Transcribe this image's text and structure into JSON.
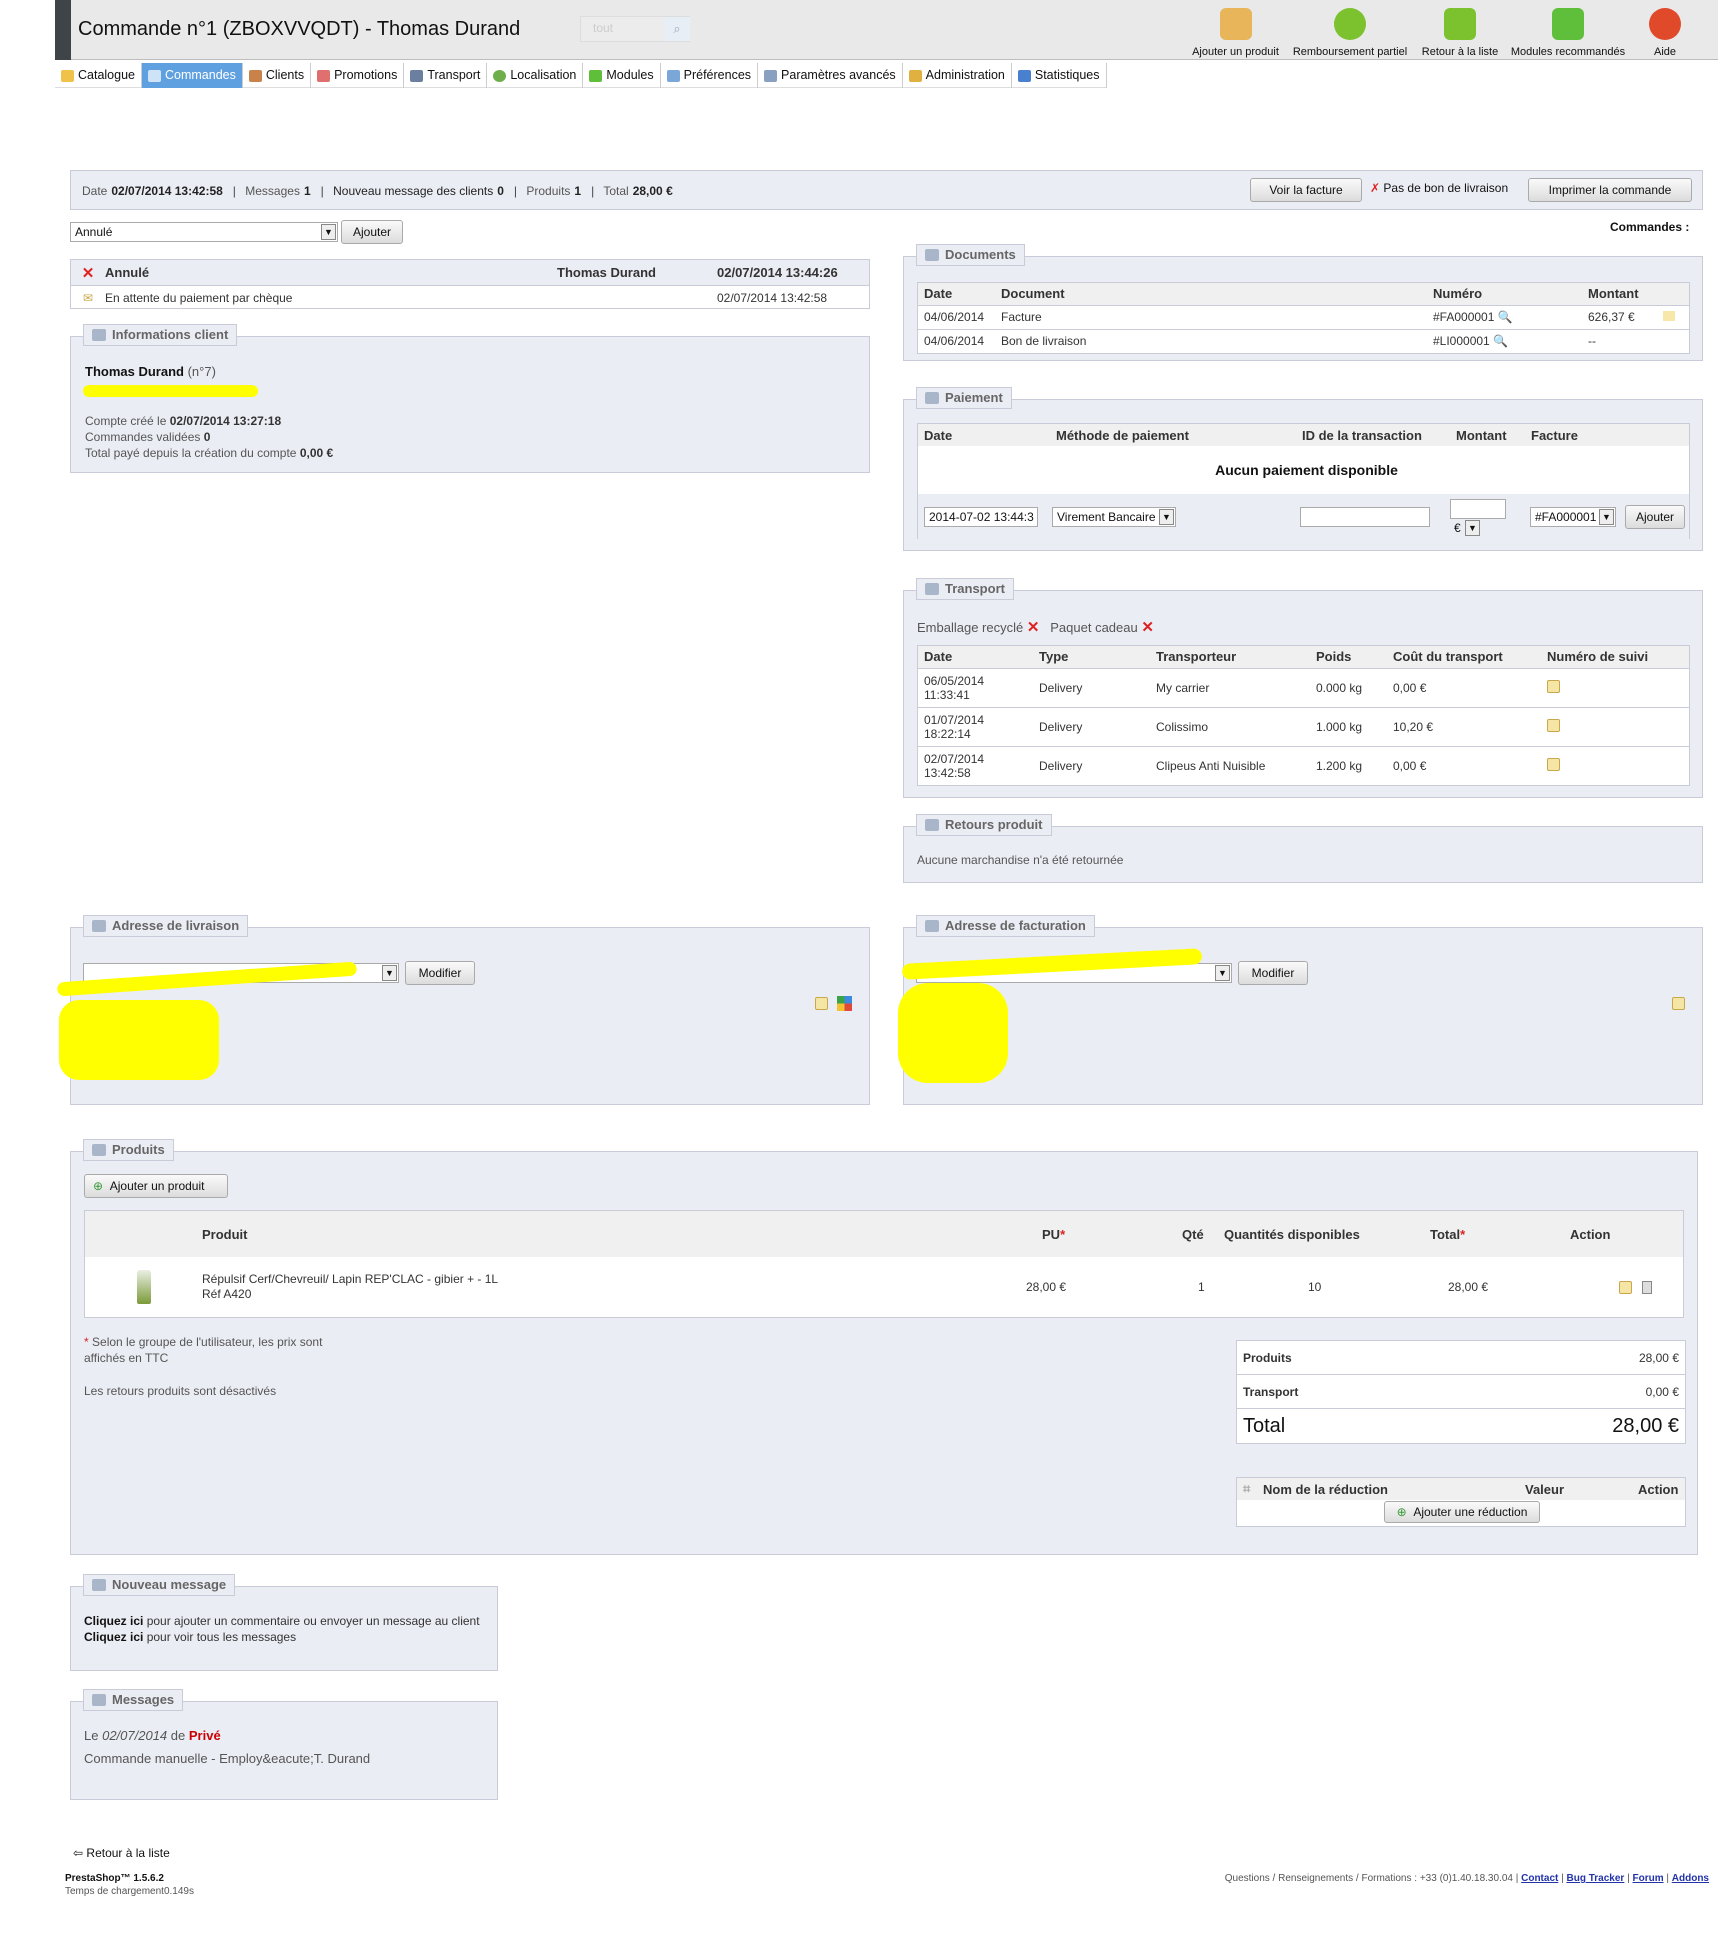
{
  "header": {
    "title": "Commande n°1 (ZBOXVVQDT) - Thomas Durand",
    "search_placeholder": "tout",
    "toolbar": [
      {
        "label": "Ajouter un produit",
        "icon": "add-product-icon",
        "color": "#e8b55a"
      },
      {
        "label": "Remboursement partiel",
        "icon": "refund-icon",
        "color": "#7cc12e"
      },
      {
        "label": "Retour à la liste",
        "icon": "back-arrow-icon",
        "color": "#7cc12e"
      },
      {
        "label": "Modules recommandés",
        "icon": "puzzle-icon",
        "color": "#5fbf3a"
      },
      {
        "label": "Aide",
        "icon": "help-lifebuoy-icon",
        "color": "#e04a2a"
      }
    ]
  },
  "nav": [
    {
      "label": "Catalogue",
      "color": "#f0c24a"
    },
    {
      "label": "Commandes",
      "color": "#cfe3f7"
    },
    {
      "label": "Clients",
      "color": "#c9834a"
    },
    {
      "label": "Promotions",
      "color": "#e07070"
    },
    {
      "label": "Transport",
      "color": "#6b7fa0"
    },
    {
      "label": "Localisation",
      "color": "#6fae4a"
    },
    {
      "label": "Modules",
      "color": "#5fbf3a"
    },
    {
      "label": "Préférences",
      "color": "#7aa7d8"
    },
    {
      "label": "Paramètres avancés",
      "color": "#8aa0c0"
    },
    {
      "label": "Administration",
      "color": "#e0b040"
    },
    {
      "label": "Statistiques",
      "color": "#4a80d0"
    }
  ],
  "summary": {
    "date_label": "Date",
    "date": "02/07/2014 13:42:58",
    "messages_label": "Messages",
    "messages": "1",
    "new_msg_label": "Nouveau message des clients",
    "new_msg": "0",
    "products_label": "Produits",
    "products": "1",
    "total_label": "Total",
    "total": "28,00 €",
    "btn_invoice": "Voir la facture",
    "no_delivery": "Pas de bon de livraison",
    "btn_print": "Imprimer la commande",
    "sep_bar": "|"
  },
  "status": {
    "select_value": "Annulé",
    "add_btn": "Ajouter",
    "history": [
      {
        "status": "Annulé",
        "employee": "Thomas Durand",
        "date": "02/07/2014 13:44:26"
      },
      {
        "status": "En attente du paiement par chèque",
        "employee": "",
        "date": "02/07/2014 13:42:58"
      }
    ]
  },
  "commandes_label": "Commandes :",
  "customer": {
    "legend": "Informations client",
    "name": "Thomas Durand",
    "num": "(n°7)",
    "created_label": "Compte créé le",
    "created": "02/07/2014 13:27:18",
    "validated_label": "Commandes validées",
    "validated": "0",
    "paid_label": "Total payé depuis la création du compte",
    "paid": "0,00 €"
  },
  "documents": {
    "legend": "Documents",
    "headers": [
      "Date",
      "Document",
      "Numéro",
      "Montant"
    ],
    "rows": [
      {
        "date": "04/06/2014",
        "doc": "Facture",
        "num": "#FA000001",
        "amount": "626,37 €"
      },
      {
        "date": "04/06/2014",
        "doc": "Bon de livraison",
        "num": "#LI000001",
        "amount": "--"
      }
    ]
  },
  "payment": {
    "legend": "Paiement",
    "headers": [
      "Date",
      "Méthode de paiement",
      "ID de la transaction",
      "Montant",
      "Facture"
    ],
    "empty": "Aucun paiement disponible",
    "date_value": "2014-07-02 13:44:3",
    "method": "Virement Bancaire",
    "currency": "€",
    "invoice": "#FA000001",
    "add_btn": "Ajouter"
  },
  "shipping": {
    "legend": "Transport",
    "recycled": "Emballage recyclé",
    "gift": "Paquet cadeau",
    "headers": [
      "Date",
      "Type",
      "Transporteur",
      "Poids",
      "Coût du transport",
      "Numéro de suivi"
    ],
    "rows": [
      {
        "date": "06/05/2014",
        "time": "11:33:41",
        "type": "Delivery",
        "carrier": "My carrier",
        "weight": "0.000 kg",
        "cost": "0,00 €"
      },
      {
        "date": "01/07/2014",
        "time": "18:22:14",
        "type": "Delivery",
        "carrier": "Colissimo",
        "weight": "1.000 kg",
        "cost": "10,20 €"
      },
      {
        "date": "02/07/2014",
        "time": "13:42:58",
        "type": "Delivery",
        "carrier": "Clipeus Anti Nuisible",
        "weight": "1.200 kg",
        "cost": "0,00 €"
      }
    ]
  },
  "returns": {
    "legend": "Retours produit",
    "text": "Aucune marchandise n'a été retournée"
  },
  "delivery_address": {
    "legend": "Adresse de livraison",
    "modify": "Modifier"
  },
  "invoice_address": {
    "legend": "Adresse de facturation",
    "modify": "Modifier"
  },
  "products": {
    "legend": "Produits",
    "add_btn": "Ajouter un produit",
    "headers": [
      "Produit",
      "PU",
      "Qté",
      "Quantités disponibles",
      "Total",
      "Action"
    ],
    "required_mark": "*",
    "items": [
      {
        "name": "Répulsif Cerf/Chevreuil/ Lapin REP'CLAC - gibier + - 1L",
        "ref": "Réf A420",
        "pu": "28,00 €",
        "qty": "1",
        "available": "10",
        "total": "28,00 €"
      }
    ],
    "note_star": "*",
    "note": "Selon le groupe de l'utilisateur, les prix sont affichés en TTC",
    "returns_off": "Les retours produits sont désactivés"
  },
  "totals": {
    "products_label": "Produits",
    "products": "28,00 €",
    "shipping_label": "Transport",
    "shipping": "0,00 €",
    "total_label": "Total",
    "total": "28,00 €"
  },
  "discount": {
    "headers": [
      "Nom de la réduction",
      "Valeur",
      "Action"
    ],
    "add_btn": "Ajouter une réduction"
  },
  "new_message": {
    "legend": "Nouveau message",
    "click": "Cliquez ici",
    "line1": "pour ajouter un commentaire ou envoyer un message au client",
    "line2": "pour voir tous les messages"
  },
  "messages": {
    "legend": "Messages",
    "prefix": "Le",
    "date": "02/07/2014",
    "from": "de",
    "author": "Privé",
    "body": "Commande manuelle - Employ&eacute;T. Durand"
  },
  "footer": {
    "back": "Retour à la liste",
    "version": "PrestaShop™ 1.5.6.2",
    "load": "Temps de chargement0.149s",
    "contact_text": "Questions / Renseignements / Formations : +33 (0)1.40.18.30.04 |",
    "links": [
      "Contact",
      "Bug Tracker",
      "Forum",
      "Addons"
    ],
    "link_sep": "|"
  }
}
